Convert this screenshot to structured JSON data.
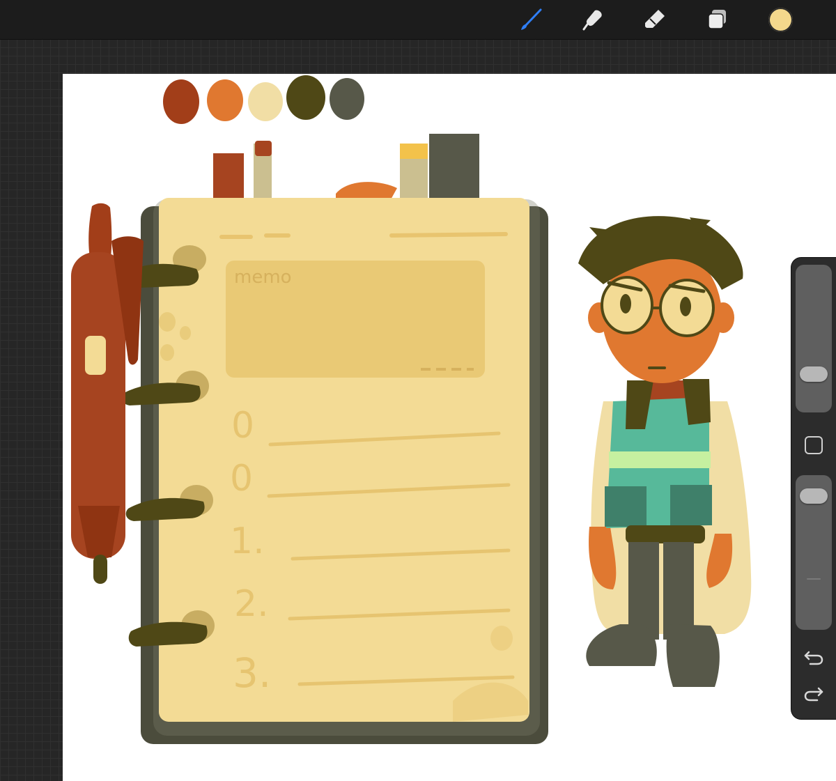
{
  "app": "Procreate",
  "toolbar": {
    "tools": [
      {
        "name": "brush-icon",
        "active": true
      },
      {
        "name": "smudge-icon",
        "active": false
      },
      {
        "name": "eraser-icon",
        "active": false
      },
      {
        "name": "layers-icon",
        "active": false
      }
    ],
    "current_color": "#f4d88c",
    "active_color": "#2f7ef6"
  },
  "canvas": {
    "palette": [
      "#a23e19",
      "#e07830",
      "#f1dea5",
      "#4f4816",
      "#575849"
    ],
    "notebook_text": {
      "memo": "memo",
      "items": [
        "0",
        "0",
        "1.",
        "2.",
        "3."
      ]
    }
  },
  "sidebar": {
    "brush_size": 0.2,
    "opacity": 0.95,
    "undo": "undo-icon",
    "redo": "redo-icon"
  }
}
